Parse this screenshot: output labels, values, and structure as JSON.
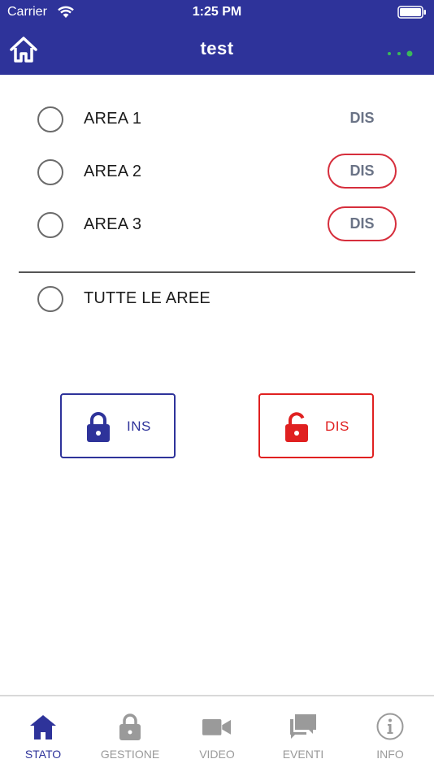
{
  "status_bar": {
    "carrier": "Carrier",
    "time": "1:25 PM"
  },
  "nav": {
    "title": "test",
    "home_icon": "home-icon",
    "menu_icon": "dots-icon"
  },
  "areas": [
    {
      "label": "AREA 1",
      "status": "DIS"
    },
    {
      "label": "AREA 2",
      "status": "DIS"
    },
    {
      "label": "AREA 3",
      "status": "DIS"
    }
  ],
  "all_areas": {
    "label": "TUTTE LE AREE"
  },
  "actions": {
    "ins_label": "INS",
    "dis_label": "DIS"
  },
  "tabs": [
    {
      "label": "STATO",
      "icon": "home-icon",
      "active": true
    },
    {
      "label": "GESTIONE",
      "icon": "lock-icon",
      "active": false
    },
    {
      "label": "VIDEO",
      "icon": "video-camera-icon",
      "active": false
    },
    {
      "label": "EVENTI",
      "icon": "chat-bubbles-icon",
      "active": false
    },
    {
      "label": "INFO",
      "icon": "info-icon",
      "active": false
    }
  ],
  "colors": {
    "primary": "#2e339a",
    "danger": "#e02020",
    "pill_border": "#d62e3c",
    "status_text": "#6a7386",
    "tab_inactive": "#9a9a9a",
    "signal_green": "#3bb85a"
  }
}
